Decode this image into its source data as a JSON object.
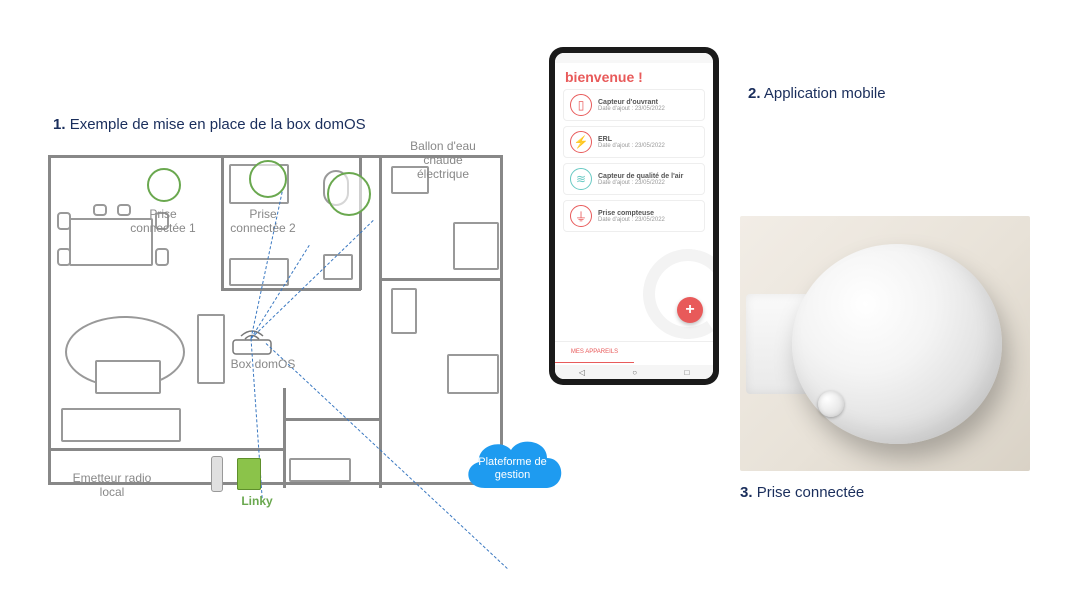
{
  "captions": {
    "c1_num": "1.",
    "c1_text": "Exemple de mise en place de la box domOS",
    "c2_num": "2.",
    "c2_text": "Application mobile",
    "c3_num": "3.",
    "c3_text": "Prise connectée"
  },
  "floorplan": {
    "ballon": "Ballon d'eau\nchaude\nélectrique",
    "prise1": "Prise\nconnectée 1",
    "prise2": "Prise\nconnectée 2",
    "box": "Box domOS",
    "emetteur": "Emetteur radio\nlocal",
    "linky": "Linky",
    "cloud": "Plateforme de\ngestion"
  },
  "app": {
    "welcome": "bienvenue !",
    "devices": [
      {
        "name": "Capteur d'ouvrant",
        "date": "Date d'ajout : 23/05/2022",
        "color": "#e85a5a",
        "glyph": "▯"
      },
      {
        "name": "ERL",
        "date": "Date d'ajout : 23/05/2022",
        "color": "#e85a5a",
        "glyph": "⚡"
      },
      {
        "name": "Capteur de qualité de l'air",
        "date": "Date d'ajout : 23/05/2022",
        "color": "#67c9c3",
        "glyph": "≋"
      },
      {
        "name": "Prise compteuse",
        "date": "Date d'ajout : 23/05/2022",
        "color": "#e85a5a",
        "glyph": "⏚"
      }
    ],
    "tabs": {
      "active": "MES APPAREILS",
      "inactive": ""
    },
    "fab": "+"
  }
}
